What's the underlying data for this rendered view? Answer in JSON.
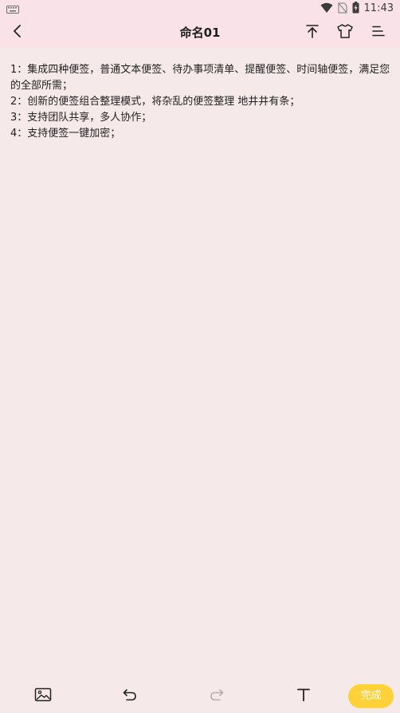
{
  "status_bar": {
    "time": "11:43",
    "icons": [
      "keyboard-icon",
      "wifi-icon",
      "no-sim-icon",
      "battery-charging-icon"
    ]
  },
  "app_bar": {
    "title": "命名01",
    "icons": [
      "back-icon",
      "pin-to-top-icon",
      "theme-shirt-icon",
      "menu-icon"
    ]
  },
  "note": {
    "lines": [
      "1：集成四种便签，普通文本便签、待办事项清单、提醒便签、时间轴便签，满足您的全部所需；",
      "2：创新的便签组合整理模式，将杂乱的便签整理 地井井有条；",
      "3：支持团队共享，多人协作；",
      "4：支持便签一键加密；"
    ]
  },
  "toolbar": {
    "icons": [
      "image-icon",
      "undo-icon",
      "redo-icon",
      "text-format-icon"
    ],
    "done_label": "完成"
  },
  "colors": {
    "header_bg": "#f9e3e8",
    "page_bg": "#f6e9e9",
    "done_button": "#ffd23a"
  }
}
